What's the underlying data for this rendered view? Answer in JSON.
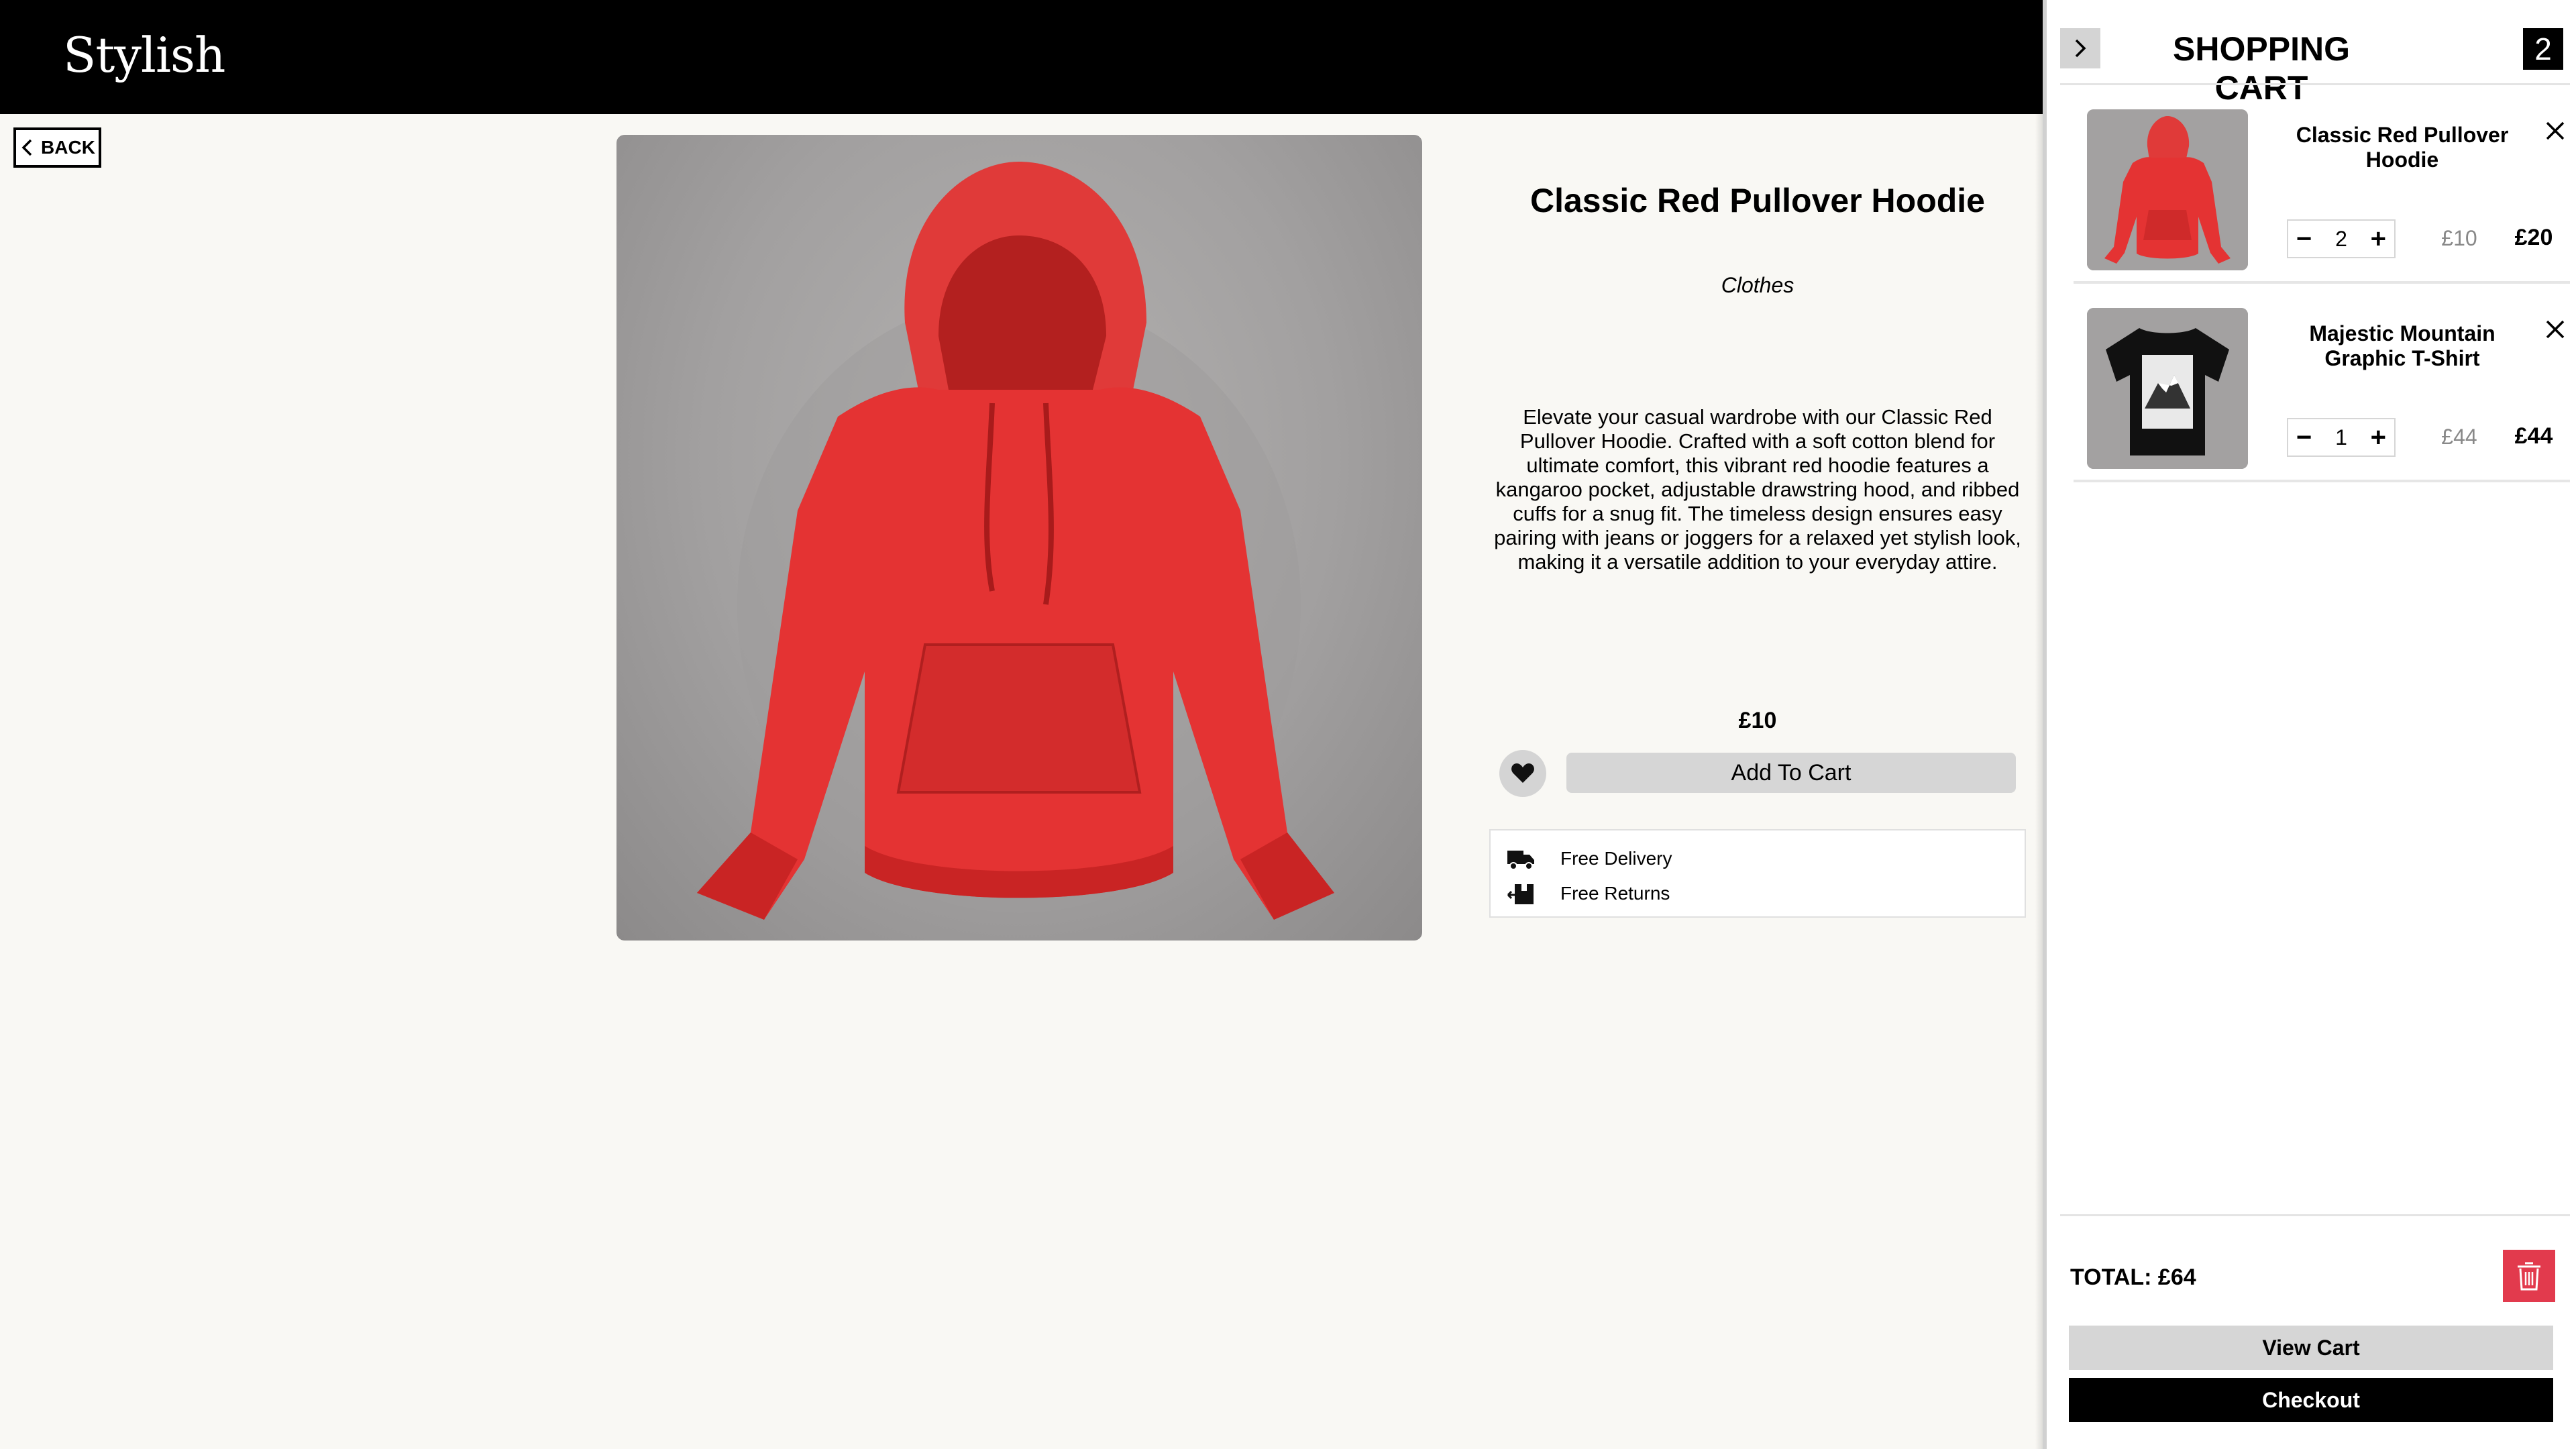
{
  "header": {
    "logo": "Stylish"
  },
  "nav": {
    "back_label": "BACK"
  },
  "product": {
    "title": "Classic Red Pullover Hoodie",
    "category": "Clothes",
    "description": "Elevate your casual wardrobe with our Classic Red Pullover Hoodie. Crafted with a soft cotton blend for ultimate comfort, this vibrant red hoodie features a kangaroo pocket, adjustable drawstring hood, and ribbed cuffs for a snug fit. The timeless design ensures easy pairing with jeans or joggers for a relaxed yet stylish look, making it a versatile addition to your everyday attire.",
    "price": "£10",
    "add_to_cart_label": "Add To Cart",
    "perks": [
      {
        "icon": "delivery-truck-icon",
        "label": "Free Delivery"
      },
      {
        "icon": "returns-box-icon",
        "label": "Free Returns"
      }
    ]
  },
  "cart": {
    "title": "SHOPPING CART",
    "count": "2",
    "items": [
      {
        "name": "Classic Red Pullover Hoodie",
        "quantity": "2",
        "unit_price": "£10",
        "line_total": "£20"
      },
      {
        "name": "Majestic Mountain Graphic T-Shirt",
        "quantity": "1",
        "unit_price": "£44",
        "line_total": "£44"
      }
    ],
    "total": "TOTAL: £64",
    "view_cart_label": "View Cart",
    "checkout_label": "Checkout"
  },
  "colors": {
    "accent_red": "#e23a4d",
    "header_bg": "#000000",
    "page_bg": "#f9f8f4",
    "button_gray": "#d6d6d6"
  }
}
